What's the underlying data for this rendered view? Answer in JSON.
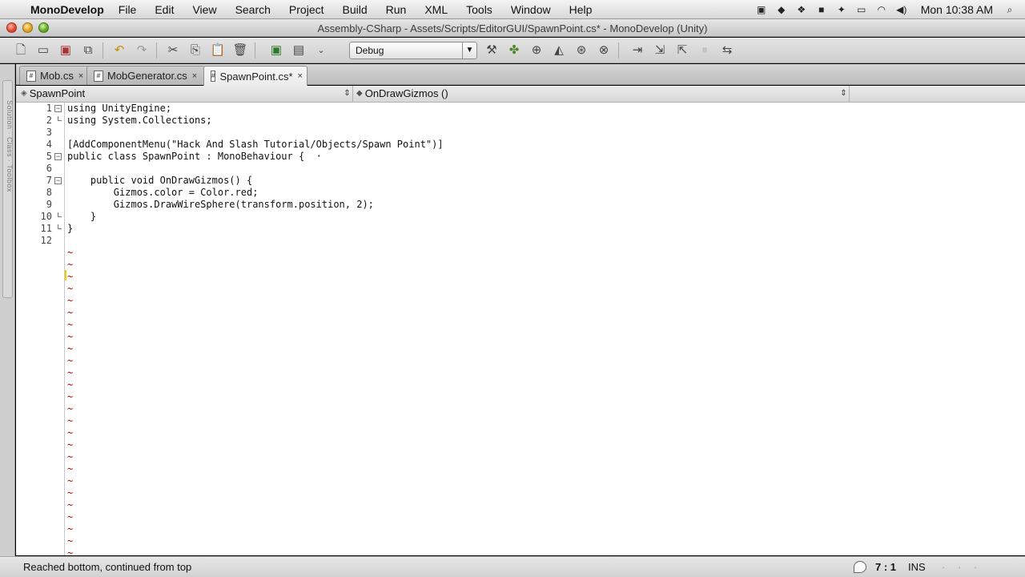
{
  "menubar": {
    "apple_glyph": "",
    "app_name": "MonoDevelop",
    "items": [
      "File",
      "Edit",
      "View",
      "Search",
      "Project",
      "Build",
      "Run",
      "XML",
      "Tools",
      "Window",
      "Help"
    ],
    "status_icons": [
      "camera-icon",
      "evernote-icon",
      "dropbox-icon",
      "notes-icon",
      "twitter-icon",
      "display-icon",
      "wifi-icon",
      "volume-icon"
    ],
    "clock": "Mon 10:38 AM",
    "spotlight_icon": "search-icon"
  },
  "window": {
    "title": "Assembly-CSharp - Assets/Scripts/EditorGUI/SpawnPoint.cs* - MonoDevelop (Unity)"
  },
  "toolbar": {
    "config_value": "Debug",
    "icons": [
      "new-file-icon",
      "open-icon",
      "save-icon",
      "save-all-icon",
      "undo-icon",
      "redo-icon",
      "cut-icon",
      "copy-icon",
      "paste-icon",
      "delete-icon",
      "build-icon",
      "rebuild-icon",
      "run-dropdown-icon",
      "build-solution-icon",
      "clean-icon",
      "attach-icon",
      "breakpoint-icon",
      "step-icon",
      "debug-icon",
      "stop-icon",
      "step-over-icon",
      "step-into-icon",
      "step-out-icon",
      "pause-icon",
      "continue-icon"
    ]
  },
  "tabs": [
    {
      "label": "Mob.cs",
      "close": "×",
      "active": false
    },
    {
      "label": "MobGenerator.cs",
      "close": "×",
      "active": false
    },
    {
      "label": "SpawnPoint.cs*",
      "close": "×",
      "active": true
    }
  ],
  "pathbar": {
    "class_name": "SpawnPoint",
    "member_name": "OnDrawGizmos ()"
  },
  "side_panel_label": "Solution · Class · Toolbox",
  "editor": {
    "line_numbers": [
      "1",
      "2",
      "3",
      "4",
      "5",
      "6",
      "7",
      "8",
      "9",
      "10",
      "11",
      "12"
    ],
    "lines": [
      "using UnityEngine;",
      "using System.Collections;",
      "",
      "[AddComponentMenu(\"Hack And Slash Tutorial/Objects/Spawn Point\")]",
      "public class SpawnPoint : MonoBehaviour {  ·",
      "",
      "    public void OnDrawGizmos() {",
      "        Gizmos.color = Color.red;",
      "        Gizmos.DrawWireSphere(transform.position, 2);",
      "    }",
      "}",
      ""
    ],
    "tilde": "~"
  },
  "statusbar": {
    "message": "Reached bottom, continued from top",
    "cursor_position": "7 : 1",
    "mode": "INS",
    "extra": "· · ·"
  }
}
